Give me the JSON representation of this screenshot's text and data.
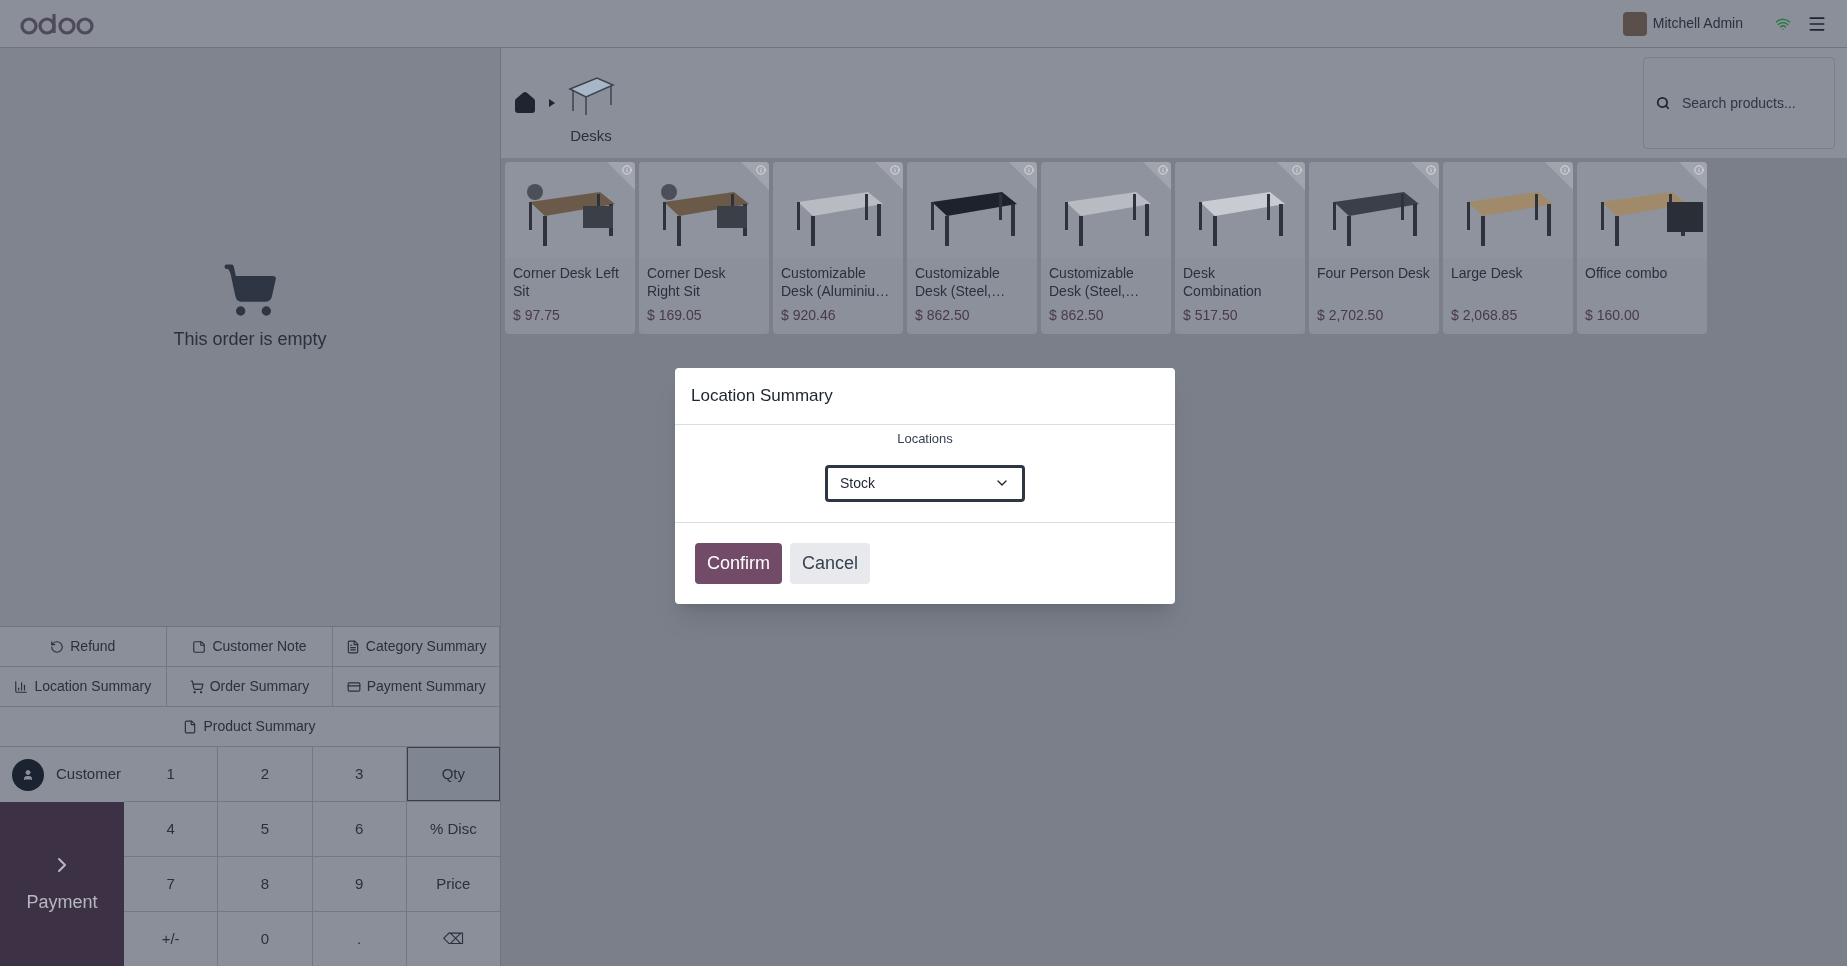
{
  "header": {
    "user": "Mitchell Admin"
  },
  "order": {
    "empty_text": "This order is empty"
  },
  "actions": [
    {
      "label": "Refund"
    },
    {
      "label": "Customer Note"
    },
    {
      "label": "Category Summary"
    },
    {
      "label": "Location Summary"
    },
    {
      "label": "Order Summary"
    },
    {
      "label": "Payment Summary"
    },
    {
      "label": "Product Summary"
    }
  ],
  "customer": {
    "label": "Customer"
  },
  "payment": {
    "label": "Payment"
  },
  "numpad": [
    {
      "label": "1",
      "selected": false
    },
    {
      "label": "2",
      "selected": false
    },
    {
      "label": "3",
      "selected": false
    },
    {
      "label": "Qty",
      "selected": true
    },
    {
      "label": "4",
      "selected": false
    },
    {
      "label": "5",
      "selected": false
    },
    {
      "label": "6",
      "selected": false
    },
    {
      "label": "% Disc",
      "selected": false
    },
    {
      "label": "7",
      "selected": false
    },
    {
      "label": "8",
      "selected": false
    },
    {
      "label": "9",
      "selected": false
    },
    {
      "label": "Price",
      "selected": false
    },
    {
      "label": "+/-",
      "selected": false
    },
    {
      "label": "0",
      "selected": false
    },
    {
      "label": ".",
      "selected": false
    },
    {
      "label": "⌫",
      "selected": false
    }
  ],
  "breadcrumb": {
    "category": "Desks"
  },
  "search": {
    "placeholder": "Search products..."
  },
  "products": [
    {
      "name": "Corner Desk Left Sit",
      "price": "$ 97.75"
    },
    {
      "name": "Corner Desk Right Sit",
      "price": "$ 169.05"
    },
    {
      "name": "Customizable Desk (Aluminiu…",
      "price": "$ 920.46"
    },
    {
      "name": "Customizable Desk (Steel,…",
      "price": "$ 862.50"
    },
    {
      "name": "Customizable Desk (Steel,…",
      "price": "$ 862.50"
    },
    {
      "name": "Desk Combination",
      "price": "$ 517.50"
    },
    {
      "name": "Four Person Desk",
      "price": "$ 2,702.50"
    },
    {
      "name": "Large Desk",
      "price": "$ 2,068.85"
    },
    {
      "name": "Office combo",
      "price": "$ 160.00"
    }
  ],
  "dialog": {
    "title": "Location Summary",
    "field_label": "Locations",
    "select_value": "Stock",
    "buttons": [
      {
        "label": "Confirm",
        "kind": "primary"
      },
      {
        "label": "Cancel",
        "kind": "secondary"
      }
    ]
  }
}
